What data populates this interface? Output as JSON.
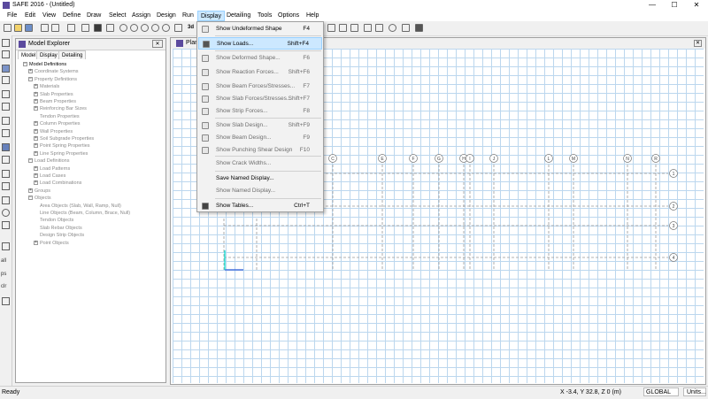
{
  "window": {
    "title": "SAFE 2016 - (Untitled)",
    "minimize": "—",
    "maximize": "☐",
    "close": "✕"
  },
  "menubar": {
    "items": [
      "File",
      "Edit",
      "View",
      "Define",
      "Draw",
      "Select",
      "Assign",
      "Design",
      "Run",
      "Display",
      "Detailing",
      "Tools",
      "Options",
      "Help"
    ],
    "active": "Display"
  },
  "explorer": {
    "title": "Model Explorer",
    "close": "✕",
    "tabs": [
      "Model",
      "Display",
      "Detailing"
    ],
    "tree": [
      {
        "indent": 0,
        "toggle": "−",
        "label": "Model Definitions",
        "dim": false
      },
      {
        "indent": 1,
        "toggle": "+",
        "label": "Coordinate Systems",
        "dim": true
      },
      {
        "indent": 1,
        "toggle": "−",
        "label": "Property Definitions",
        "dim": true
      },
      {
        "indent": 2,
        "toggle": "+",
        "label": "Materials",
        "dim": true
      },
      {
        "indent": 2,
        "toggle": "+",
        "label": "Slab Properties",
        "dim": true
      },
      {
        "indent": 2,
        "toggle": "+",
        "label": "Beam Properties",
        "dim": true
      },
      {
        "indent": 2,
        "toggle": "+",
        "label": "Reinforcing Bar Sizes",
        "dim": true
      },
      {
        "indent": 2,
        "toggle": "",
        "label": "Tendon Properties",
        "dim": true
      },
      {
        "indent": 2,
        "toggle": "+",
        "label": "Column Properties",
        "dim": true
      },
      {
        "indent": 2,
        "toggle": "+",
        "label": "Wall Properties",
        "dim": true
      },
      {
        "indent": 2,
        "toggle": "+",
        "label": "Soil Subgrade Properties",
        "dim": true
      },
      {
        "indent": 2,
        "toggle": "+",
        "label": "Point Spring Properties",
        "dim": true
      },
      {
        "indent": 2,
        "toggle": "+",
        "label": "Line Spring Properties",
        "dim": true
      },
      {
        "indent": 1,
        "toggle": "−",
        "label": "Load Definitions",
        "dim": true
      },
      {
        "indent": 2,
        "toggle": "+",
        "label": "Load Patterns",
        "dim": true
      },
      {
        "indent": 2,
        "toggle": "+",
        "label": "Load Cases",
        "dim": true
      },
      {
        "indent": 2,
        "toggle": "+",
        "label": "Load Combinations",
        "dim": true
      },
      {
        "indent": 1,
        "toggle": "+",
        "label": "Groups",
        "dim": true
      },
      {
        "indent": 1,
        "toggle": "−",
        "label": "Objects",
        "dim": true
      },
      {
        "indent": 2,
        "toggle": "",
        "label": "Area Objects (Slab, Wall, Ramp, Null)",
        "dim": true
      },
      {
        "indent": 2,
        "toggle": "",
        "label": "Line Objects (Beam, Column, Brace, Null)",
        "dim": true
      },
      {
        "indent": 2,
        "toggle": "",
        "label": "Tendon Objects",
        "dim": true
      },
      {
        "indent": 2,
        "toggle": "",
        "label": "Slab Rebar Objects",
        "dim": true
      },
      {
        "indent": 2,
        "toggle": "",
        "label": "Design Strip Objects",
        "dim": true
      },
      {
        "indent": 2,
        "toggle": "+",
        "label": "Point Objects",
        "dim": true
      }
    ]
  },
  "canvas": {
    "title": "Plan",
    "close": "✕",
    "top_labels": [
      "C",
      "E",
      "F",
      "G",
      "H",
      "I",
      "J",
      "L",
      "M",
      "N",
      "R"
    ],
    "right_labels": [
      "1",
      "2",
      "3",
      "4"
    ]
  },
  "dropdown": {
    "items": [
      {
        "label": "Show Undeformed Shape",
        "shortcut": "F4",
        "icon": "undeformed-shape-icon",
        "disabled": false
      },
      {
        "label": "Show Loads...",
        "shortcut": "Shift+F4",
        "icon": "loads-icon",
        "disabled": false,
        "highlight": true
      },
      {
        "label": "Show Deformed Shape...",
        "shortcut": "F6",
        "icon": "deformed-shape-icon",
        "disabled": true
      },
      {
        "label": "Show Reaction Forces...",
        "shortcut": "Shift+F6",
        "icon": "reaction-forces-icon",
        "disabled": true
      },
      {
        "label": "Show Beam Forces/Stresses...",
        "shortcut": "F7",
        "icon": "beam-forces-icon",
        "disabled": true
      },
      {
        "label": "Show Slab Forces/Stresses...",
        "shortcut": "Shift+F7",
        "icon": "slab-forces-icon",
        "disabled": true
      },
      {
        "label": "Show Strip Forces...",
        "shortcut": "F8",
        "icon": "strip-forces-icon",
        "disabled": true
      },
      {
        "label": "Show Slab Design...",
        "shortcut": "Shift+F9",
        "icon": "slab-design-icon",
        "disabled": true
      },
      {
        "label": "Show Beam Design...",
        "shortcut": "F9",
        "icon": "beam-design-icon",
        "disabled": true
      },
      {
        "label": "Show Punching Shear Design",
        "shortcut": "F10",
        "icon": "punching-shear-icon",
        "disabled": true
      },
      {
        "label": "Show Crack Widths...",
        "shortcut": "",
        "icon": "",
        "disabled": true
      },
      {
        "label": "Save Named Display...",
        "shortcut": "",
        "icon": "",
        "disabled": false
      },
      {
        "label": "Show Named Display...",
        "shortcut": "",
        "icon": "",
        "disabled": true
      },
      {
        "label": "Show Tables...",
        "shortcut": "Ctrl+T",
        "icon": "tables-icon",
        "disabled": false
      }
    ]
  },
  "statusbar": {
    "left": "Ready",
    "coords": "X -3.4,  Y 32.8,  Z 0   (m)",
    "coord_system": "GLOBAL",
    "units": "Units..."
  },
  "left_toolbar_text": [
    "all",
    "ps",
    "clr"
  ],
  "colors": {
    "grid_line": "#bcd7ee",
    "grid_dash": "#9a9a9a",
    "axis_x": "#2b5bd7",
    "axis_y": "#00e0d0",
    "menu_highlight": "#cce8ff"
  }
}
